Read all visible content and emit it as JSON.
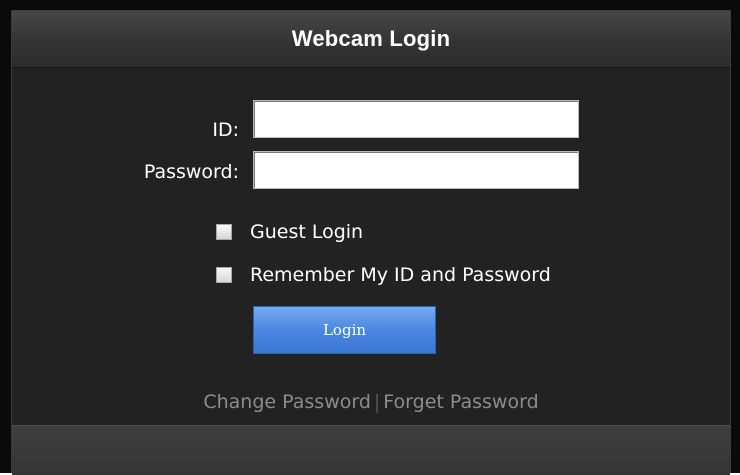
{
  "header": {
    "title": "Webcam Login"
  },
  "form": {
    "id_label": "ID:",
    "id_value": "",
    "password_label": "Password:",
    "password_value": ""
  },
  "options": {
    "guest_login_label": "Guest Login",
    "guest_login_checked": false,
    "remember_label": "Remember My ID and Password",
    "remember_checked": false
  },
  "login_button": {
    "label": "Login"
  },
  "links": {
    "change_password": "Change Password",
    "separator": "|",
    "forget_password": "Forget Password"
  },
  "colors": {
    "background": "#222222",
    "header_text": "#ffffff",
    "button_blue": "#4b87e1",
    "link_gray": "#8c8c8c"
  }
}
